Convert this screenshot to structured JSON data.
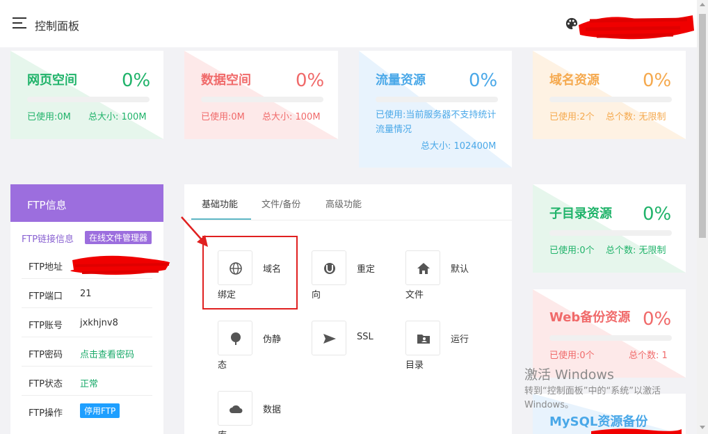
{
  "header": {
    "title": "控制面板"
  },
  "stats": [
    {
      "title": "网页空间",
      "percent": "0%",
      "line1": "已使用:0M",
      "line2": "总大小: 100M",
      "color": "#20b36a",
      "tint": "#e6f6ec"
    },
    {
      "title": "数据空间",
      "percent": "0%",
      "line1": "已使用:0M",
      "line2": "总大小: 100M",
      "color": "#f06a6a",
      "tint": "#fde9e9"
    },
    {
      "title": "流量资源",
      "percent": "0%",
      "line1": "已使用:当前服务器不支持统计流量情况",
      "line2": "总大小: 102400M",
      "color": "#4aa8e8",
      "tint": "#e8f3fd"
    },
    {
      "title": "域名资源",
      "percent": "0%",
      "line1": "已使用:2个",
      "line2": "总个数: 无限制",
      "color": "#f5a94e",
      "tint": "#fef2e3"
    },
    {
      "title": "子目录资源",
      "percent": "0%",
      "line1": "已使用:0个",
      "line2": "总个数: 无限制",
      "color": "#20b36a",
      "tint": "#e6f6ec"
    },
    {
      "title": "Web备份资源",
      "percent": "0%",
      "line1": "已使用:0个",
      "line2": "总个数: 1",
      "color": "#f06a6a",
      "tint": "#fde9e9"
    },
    {
      "title": "MySQL资源备份",
      "color": "#4aa8e8"
    }
  ],
  "ftp": {
    "header": "FTP信息",
    "conn_label": "FTP链接信息",
    "file_manager_badge": "在线文件管理器",
    "rows": [
      {
        "key": "FTP地址",
        "value": ""
      },
      {
        "key": "FTP端口",
        "value": "21"
      },
      {
        "key": "FTP账号",
        "value": "jxkhjnv8"
      },
      {
        "key": "FTP密码",
        "value": "点击查看密码"
      },
      {
        "key": "FTP状态",
        "value": "正常"
      },
      {
        "key": "FTP操作",
        "value": "停用FTP"
      }
    ]
  },
  "functions": {
    "tabs": [
      "基础功能",
      "文件/备份",
      "高级功能"
    ],
    "items": [
      {
        "icon": "globe-icon",
        "label_a": "域名",
        "label_b": "绑定"
      },
      {
        "icon": "redirect-icon",
        "label_a": "重定",
        "label_b": "向"
      },
      {
        "icon": "home-icon",
        "label_a": "默认",
        "label_b": "文件"
      },
      {
        "icon": "tree-icon",
        "label_a": "伪静",
        "label_b": "态"
      },
      {
        "icon": "send-icon",
        "label_a": "SSL",
        "label_b": ""
      },
      {
        "icon": "folder-user-icon",
        "label_a": "运行",
        "label_b": "目录"
      },
      {
        "icon": "cloud-icon",
        "label_a": "数据",
        "label_b": "库"
      }
    ]
  },
  "watermark": {
    "line1": "激活 Windows",
    "line2": "转到“控制面板”中的“系统”以激活 Windows。"
  }
}
